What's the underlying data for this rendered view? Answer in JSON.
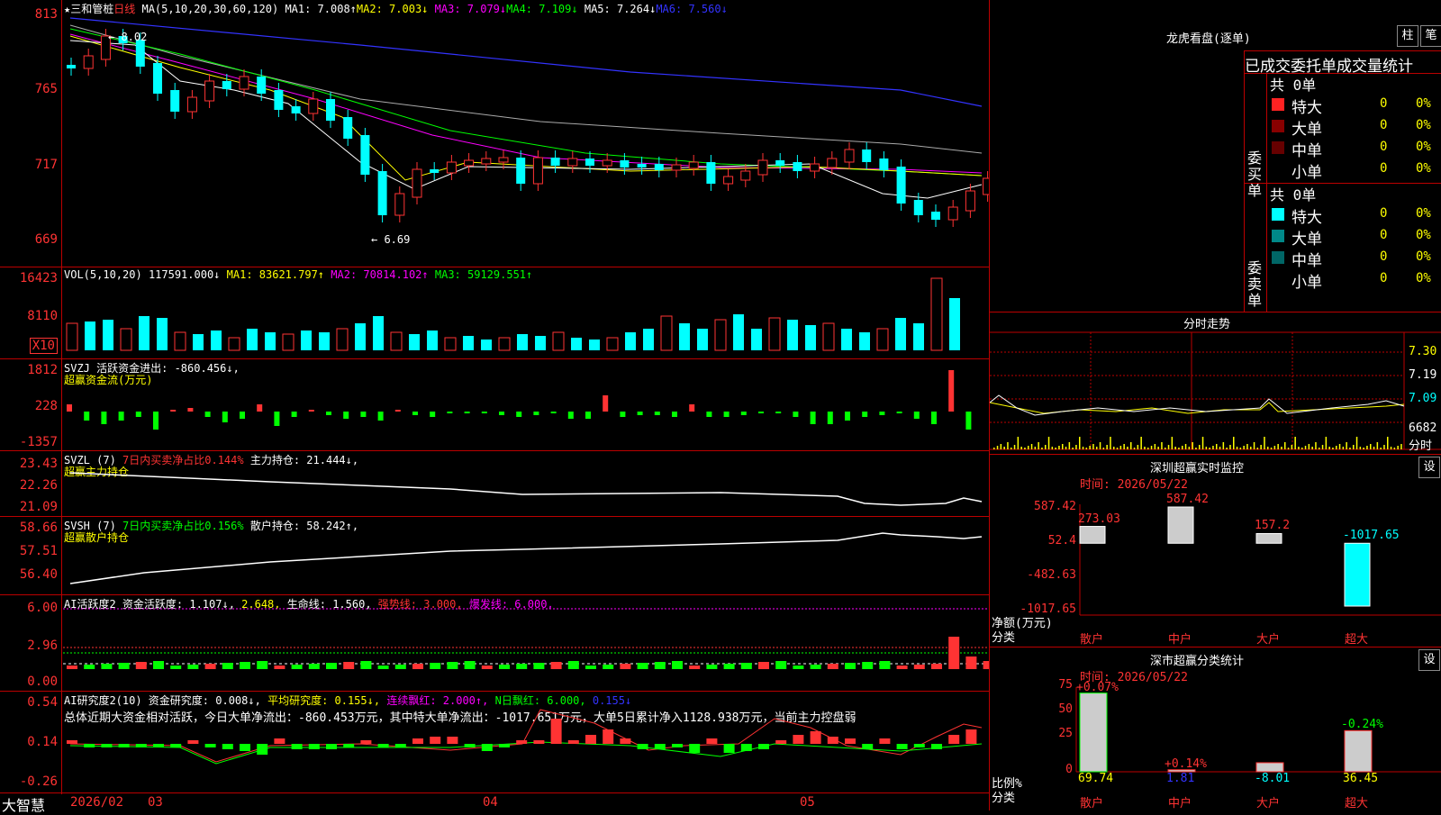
{
  "stock": {
    "name": "★三和管桩",
    "period": "日线"
  },
  "ma_header": {
    "prefix": "MA(5,10,20,30,60,120)",
    "ma1": "MA1: 7.008↑",
    "ma2": "MA2: 7.003↓",
    "ma3": "MA3: 7.079↓",
    "ma4": "MA4: 7.109↓",
    "ma5": "MA5: 7.264↓",
    "ma6": "MA6: 7.560↓"
  },
  "price_axis": [
    "813",
    "765",
    "717",
    "669"
  ],
  "price_marks": {
    "high": "8.02",
    "low": "6.69"
  },
  "vol_header": {
    "prefix": "VOL(5,10,20)",
    "val": "117591.000↓",
    "ma1": "MA1: 83621.797↑",
    "ma2": "MA2: 70814.102↑",
    "ma3": "MA3: 59129.551↑"
  },
  "vol_axis": [
    "16423",
    "8110"
  ],
  "vol_unit": "X10",
  "svzj": {
    "header": "SVZJ  活跃资金进出: -860.456↓,",
    "sub": "超赢资金流(万元)",
    "axis": [
      "1812",
      "228",
      "-1357"
    ]
  },
  "svzl": {
    "header_a": "SVZL (7)",
    "header_b": "7日内买卖净占比0.144%",
    "header_c": "主力持仓: 21.444↓,",
    "sub": "超赢主力持仓",
    "axis": [
      "23.43",
      "22.26",
      "21.09"
    ]
  },
  "svsh": {
    "header_a": "SVSH (7)",
    "header_b": "7日内买卖净占比0.156%",
    "header_c": "散户持仓: 58.242↑,",
    "sub": "超赢散户持仓",
    "axis": [
      "58.66",
      "57.51",
      "56.40"
    ]
  },
  "ai_active": {
    "header_a": "AI活跃度2 资金活跃度: 1.107↓,",
    "header_b": "2.648,",
    "header_c": "生命线: 1.560,",
    "header_d": "强势线: 3.000,",
    "header_e": "爆发线: 6.000,",
    "axis": [
      "6.00",
      "2.96",
      "0.00"
    ]
  },
  "ai_research": {
    "header_a": "AI研究度2(10) 资金研究度: 0.008↓,",
    "header_b": "平均研究度: 0.155↓,",
    "header_c": "连续飘红: 2.000↑,",
    "header_d": "N日飘红: 6.000,",
    "header_e": "0.155↓",
    "summary": "总体近期大资金相对活跃，今日大单净流出：-860.453万元，其中特大单净流出：-1017.651万元，大单5日累计净入1128.938万元，当前主力控盘弱",
    "axis": [
      "0.54",
      "0.14",
      "-0.26"
    ]
  },
  "time_axis": {
    "brand": "大智慧",
    "labels": [
      "2026/02",
      "03",
      "04",
      "05"
    ]
  },
  "dragon": {
    "title": "龙虎看盘(逐单)",
    "btn1": "柱",
    "btn2": "笔",
    "subtitle": "已成交委托单成交量统计",
    "buy_label": "委买单",
    "sell_label": "委卖单",
    "buy": {
      "total": "共 0单",
      "rows": [
        {
          "label": "特大",
          "n": "0",
          "p": "0%"
        },
        {
          "label": "大单",
          "n": "0",
          "p": "0%"
        },
        {
          "label": "中单",
          "n": "0",
          "p": "0%"
        },
        {
          "label": "小单",
          "n": "0",
          "p": "0%"
        }
      ]
    },
    "sell": {
      "total": "共 0单",
      "rows": [
        {
          "label": "特大",
          "n": "0",
          "p": "0%"
        },
        {
          "label": "大单",
          "n": "0",
          "p": "0%"
        },
        {
          "label": "中单",
          "n": "0",
          "p": "0%"
        },
        {
          "label": "小单",
          "n": "0",
          "p": "0%"
        }
      ]
    }
  },
  "intraday": {
    "title": "分时走势",
    "axis": [
      "7.30",
      "7.19",
      "7.09",
      "6682",
      "分时"
    ]
  },
  "monitor": {
    "title": "深圳超赢实时监控",
    "set": "设",
    "time": "时间: 2026/05/22",
    "axis": [
      "587.42",
      "52.4",
      "-482.63",
      "-1017.65"
    ],
    "ylabel": "净额(万元)",
    "xlabel": "分类",
    "cats": [
      "散户",
      "中户",
      "大户",
      "超大"
    ],
    "labels": [
      "273.03",
      "587.42",
      "157.2",
      "-1017.65"
    ]
  },
  "classify": {
    "title": "深市超赢分类统计",
    "set": "设",
    "time": "时间: 2026/05/22",
    "axis": [
      "75",
      "50",
      "25",
      "0"
    ],
    "ylabel": "比例%",
    "xlabel": "分类",
    "cats": [
      "散户",
      "中户",
      "大户",
      "超大"
    ],
    "top": [
      "+0.07%",
      "+0.14%",
      "",
      "-0.24%"
    ],
    "bottom": [
      "69.74",
      "1.81",
      "-8.01",
      "36.45"
    ]
  },
  "chart_data": {
    "type": "bar",
    "title": "深圳超赢实时监控",
    "categories": [
      "散户",
      "中户",
      "大户",
      "超大"
    ],
    "values": [
      273.03,
      587.42,
      157.2,
      -1017.65
    ],
    "ylabel": "净额(万元)",
    "ylim": [
      -1017.65,
      587.42
    ]
  },
  "colors": {
    "up": "#ff3333",
    "down": "#00ffff",
    "grid": "#bb0000",
    "ma1": "#ffffff",
    "ma2": "#ffff00",
    "ma3": "#ff00ff",
    "ma4": "#00ff00",
    "ma5": "#aaaaaa",
    "ma6": "#3333ff"
  }
}
